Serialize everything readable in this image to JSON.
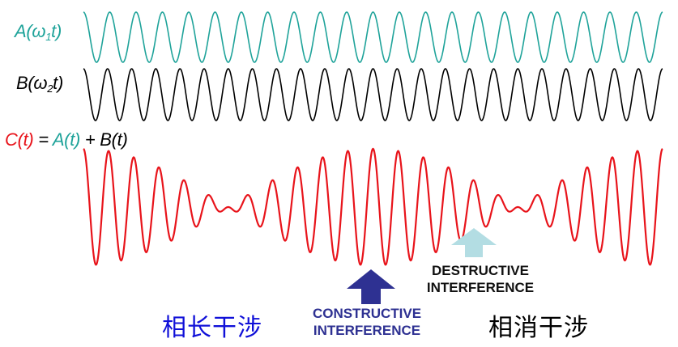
{
  "labels": {
    "a_base": "A(ω",
    "a_sub": "1",
    "a_tail": "t)",
    "b_base": "B(ω",
    "b_sub": "2",
    "b_tail": "t)",
    "c_left": "C(t)",
    "c_eq": " = ",
    "c_a": "A(t)",
    "c_plus": " + ",
    "c_b": "B(t)"
  },
  "annotations": {
    "constructive_line1": "CONSTRUCTIVE",
    "constructive_line2": "INTERFERENCE",
    "destructive_line1": "DESTRUCTIVE",
    "destructive_line2": "INTERFERENCE",
    "cn_constructive": "相长干涉",
    "cn_destructive": "相消干涉"
  },
  "colors": {
    "wave_a": "#1fa39a",
    "wave_b": "#000000",
    "wave_c": "#e8141b",
    "arrow_constructive": "#2e3192",
    "arrow_destructive": "#b3dde3"
  },
  "waves": {
    "a_cycles": 22,
    "b_cycles": 24
  }
}
